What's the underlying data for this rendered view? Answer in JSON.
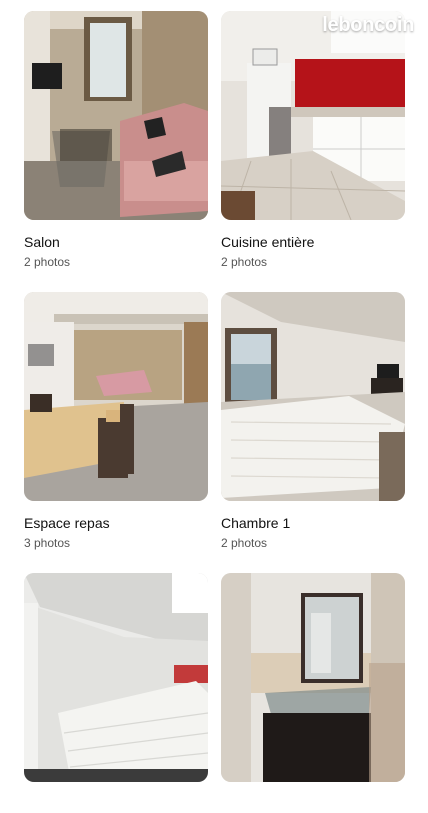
{
  "watermark": "leboncoin",
  "rooms": [
    {
      "title": "Salon",
      "photos": "2 photos",
      "image": "living-room-photo"
    },
    {
      "title": "Cuisine entière",
      "photos": "2 photos",
      "image": "kitchen-photo"
    },
    {
      "title": "Espace repas",
      "photos": "3 photos",
      "image": "dining-area-photo"
    },
    {
      "title": "Chambre 1",
      "photos": "2 photos",
      "image": "bedroom-1-photo"
    },
    {
      "title": "",
      "photos": "",
      "image": "bedroom-2-photo"
    },
    {
      "title": "",
      "photos": "",
      "image": "bathroom-photo"
    }
  ],
  "colors": {
    "background": "#ffffff",
    "title": "#111111",
    "subtitle": "#555555",
    "kitchen_accent": "#c0131a",
    "sofa": "#d39a9a"
  }
}
